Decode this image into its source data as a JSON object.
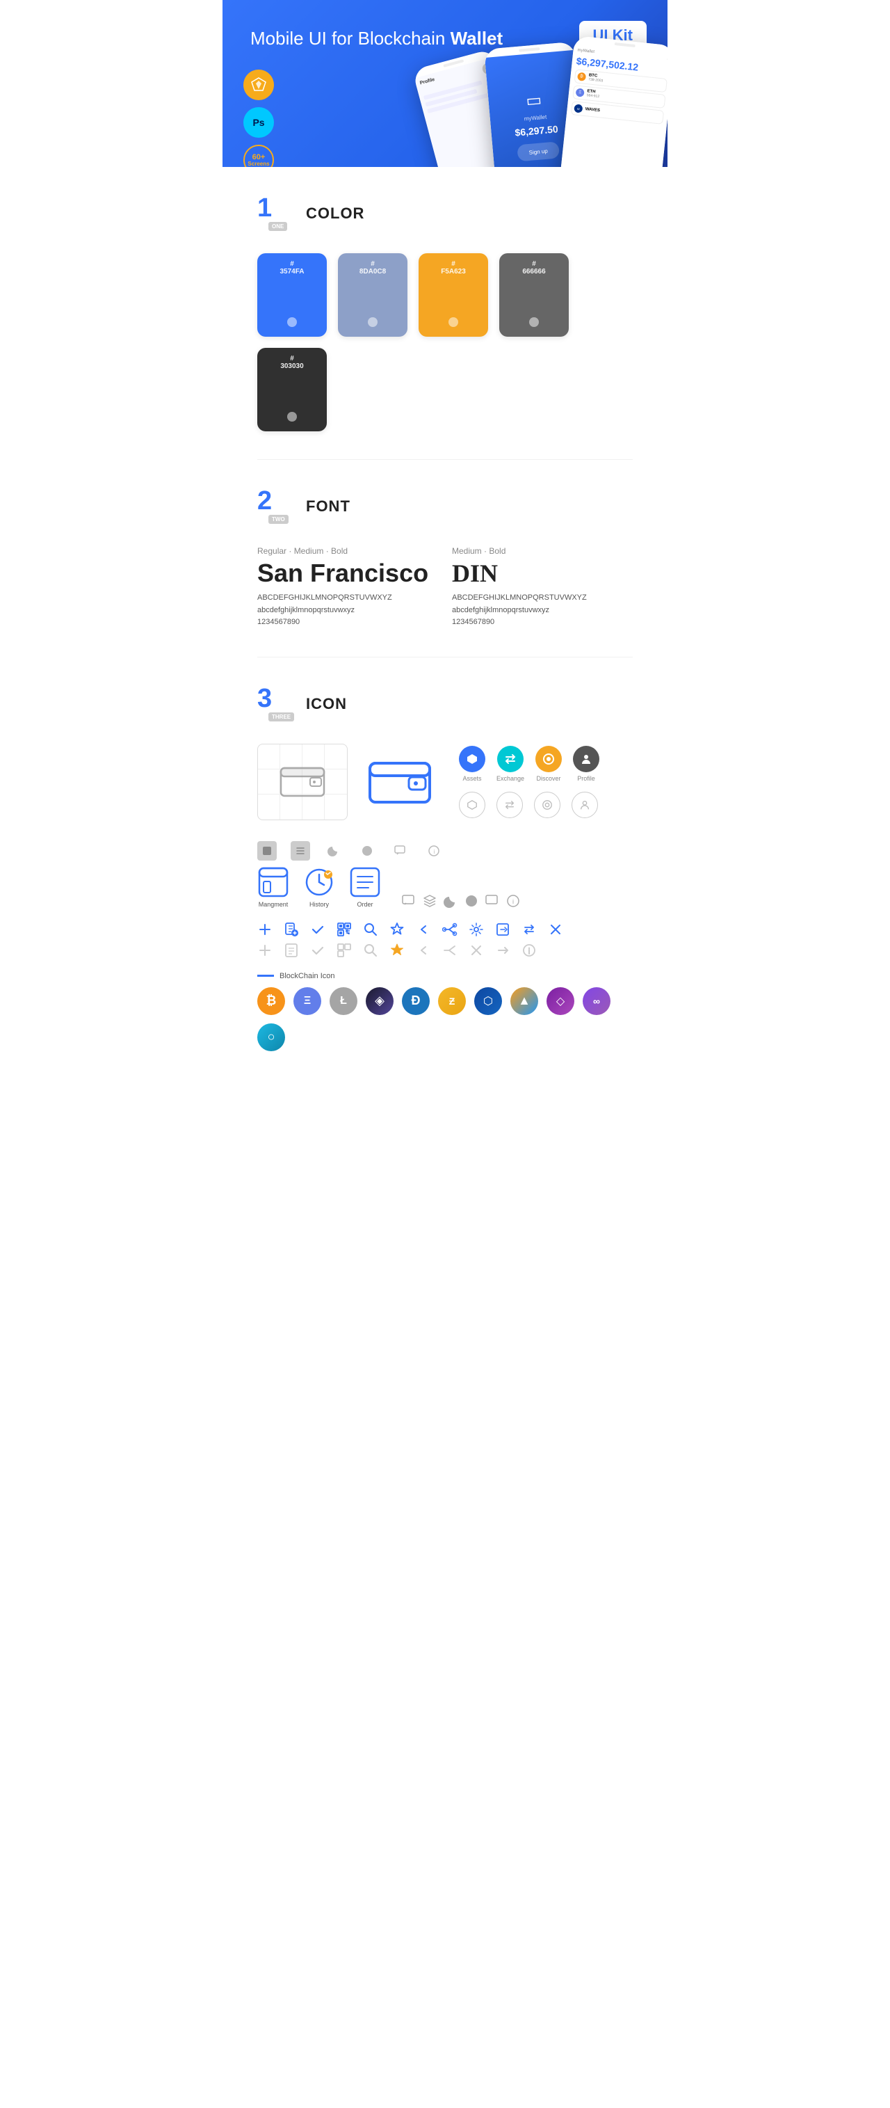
{
  "hero": {
    "title_regular": "Mobile UI for Blockchain ",
    "title_bold": "Wallet",
    "badge": "UI Kit",
    "badges": [
      {
        "label": "Sketch",
        "type": "sketch"
      },
      {
        "label": "Ps",
        "type": "ps"
      },
      {
        "label": "60+\nScreens",
        "type": "screens"
      }
    ]
  },
  "sections": {
    "color": {
      "number": "1",
      "label": "ONE",
      "title": "COLOR",
      "swatches": [
        {
          "hex": "#3574FA",
          "code": "#\n3574FA"
        },
        {
          "hex": "#8DA0C8",
          "code": "#\n8DA0C8"
        },
        {
          "hex": "#F5A623",
          "code": "#\nF5A623"
        },
        {
          "hex": "#666666",
          "code": "#\n666666"
        },
        {
          "hex": "#303030",
          "code": "#\n303030"
        }
      ]
    },
    "font": {
      "number": "2",
      "label": "TWO",
      "title": "FONT",
      "fonts": [
        {
          "meta": "Regular · Medium · Bold",
          "name": "San Francisco",
          "uppercase": "ABCDEFGHIJKLMNOPQRSTUVWXYZ",
          "lowercase": "abcdefghijklmnopqrstuvwxyz",
          "numbers": "1234567890"
        },
        {
          "meta": "Medium · Bold",
          "name": "DIN",
          "uppercase": "ABCDEFGHIJKLMNOPQRSTUVWXYZ",
          "lowercase": "abcdefghijklmnopqrstuvwxyz",
          "numbers": "1234567890"
        }
      ]
    },
    "icon": {
      "number": "3",
      "label": "THREE",
      "title": "ICON",
      "nav_icons": [
        {
          "label": "Assets",
          "color": "blue"
        },
        {
          "label": "Exchange",
          "color": "cyan"
        },
        {
          "label": "Discover",
          "color": "orange"
        },
        {
          "label": "Profile",
          "color": "dark"
        }
      ],
      "bottom_icons": [
        {
          "label": "Mangment"
        },
        {
          "label": "History"
        },
        {
          "label": "Order"
        }
      ],
      "blockchain_label": "BlockChain Icon",
      "crypto_icons": [
        "₿",
        "Ξ",
        "Ł",
        "◈",
        "Đ",
        "Ƶ",
        "⬡",
        "◆",
        "◇",
        "∞",
        "○"
      ]
    }
  }
}
